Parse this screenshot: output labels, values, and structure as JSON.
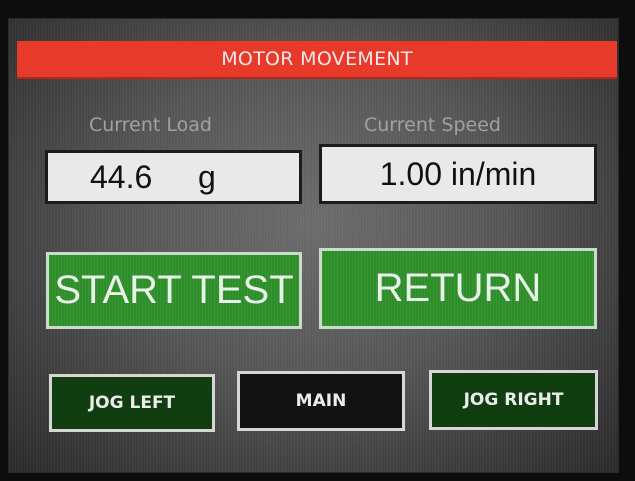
{
  "header": {
    "title": "MOTOR MOVEMENT"
  },
  "readouts": {
    "load": {
      "label": "Current Load",
      "value": "44.6",
      "unit": "g"
    },
    "speed": {
      "label": "Current Speed",
      "value": "1.00 in/min"
    }
  },
  "buttons": {
    "start_test": "START TEST",
    "return": "RETURN",
    "jog_left": "JOG LEFT",
    "main": "MAIN",
    "jog_right": "JOG RIGHT"
  },
  "colors": {
    "title_bar": "#e83a2a",
    "big_button_green": "#2e8f2a",
    "small_button_green": "#103e10",
    "main_button": "#121212",
    "readout_background": "#e9e9e9"
  }
}
